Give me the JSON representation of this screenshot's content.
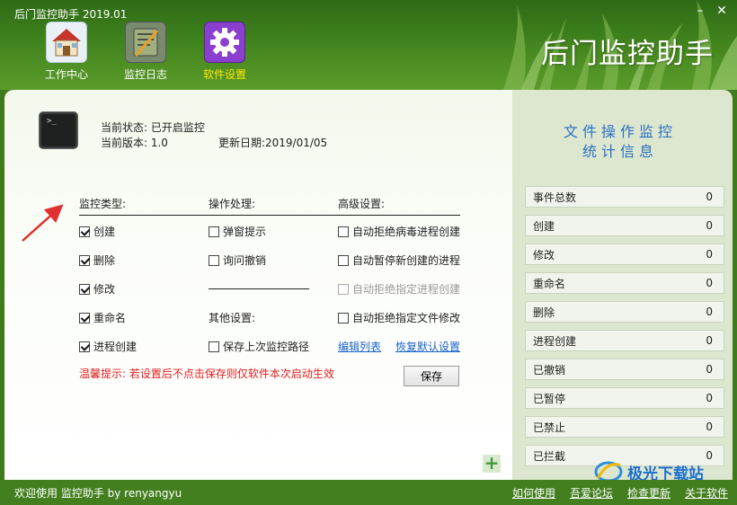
{
  "window": {
    "title": "后门监控助手 2019.01",
    "min": "–",
    "close": "✕"
  },
  "brand": "后门监控助手",
  "nav": [
    {
      "label": "工作中心",
      "icon": "house-icon"
    },
    {
      "label": "监控日志",
      "icon": "notebook-icon"
    },
    {
      "label": "软件设置",
      "icon": "gear-icon",
      "active": true
    }
  ],
  "status": {
    "state": "当前状态: 已开启监控",
    "version": "当前版本: 1.0",
    "date": "更新日期:2019/01/05"
  },
  "headers": {
    "monitor_type": "监控类型:",
    "action": "操作处理:",
    "advanced": "高级设置:"
  },
  "monitor_types": [
    {
      "label": "创建",
      "checked": true
    },
    {
      "label": "删除",
      "checked": true
    },
    {
      "label": "修改",
      "checked": true
    },
    {
      "label": "重命名",
      "checked": true
    },
    {
      "label": "进程创建",
      "checked": true
    }
  ],
  "actions": [
    {
      "label": "弹窗提示",
      "checked": false
    },
    {
      "label": "询问撤销",
      "checked": false
    }
  ],
  "other_settings": "其他设置:",
  "save_path": {
    "label": "保存上次监控路径",
    "checked": false
  },
  "advanced": [
    {
      "label": "自动拒绝病毒进程创建",
      "checked": false,
      "disabled": false
    },
    {
      "label": "自动暂停新创建的进程",
      "checked": false,
      "disabled": false
    },
    {
      "label": "自动拒绝指定进程创建",
      "checked": false,
      "disabled": true
    },
    {
      "label": "自动拒绝指定文件修改",
      "checked": false,
      "disabled": false
    }
  ],
  "links": {
    "edit_list": "编辑列表",
    "restore_default": "恢复默认设置"
  },
  "warning": "温馨提示: 若设置后不点击保存则仅软件本次启动生效",
  "save_label": "保存",
  "plus": "+",
  "side": {
    "title_line1": "文件操作监控",
    "title_line2": "统计信息",
    "stats": [
      {
        "label": "事件总数",
        "value": "0"
      },
      {
        "label": "创建",
        "value": "0"
      },
      {
        "label": "修改",
        "value": "0"
      },
      {
        "label": "重命名",
        "value": "0"
      },
      {
        "label": "删除",
        "value": "0"
      },
      {
        "label": "进程创建",
        "value": "0"
      },
      {
        "label": "已撤销",
        "value": "0"
      },
      {
        "label": "已暂停",
        "value": "0"
      },
      {
        "label": "已禁止",
        "value": "0"
      },
      {
        "label": "已拦截",
        "value": "0"
      }
    ]
  },
  "footer": {
    "welcome": "欢迎使用 监控助手  by  renyangyu",
    "links": [
      "如何使用",
      "吾爱论坛",
      "检查更新",
      "关于软件"
    ]
  },
  "watermark": "极光下载站",
  "colors": {
    "header_green": "#3b7d1b",
    "accent_blue": "#2a72c4",
    "warning_red": "#e02020",
    "active_nav": "#ffe800"
  }
}
